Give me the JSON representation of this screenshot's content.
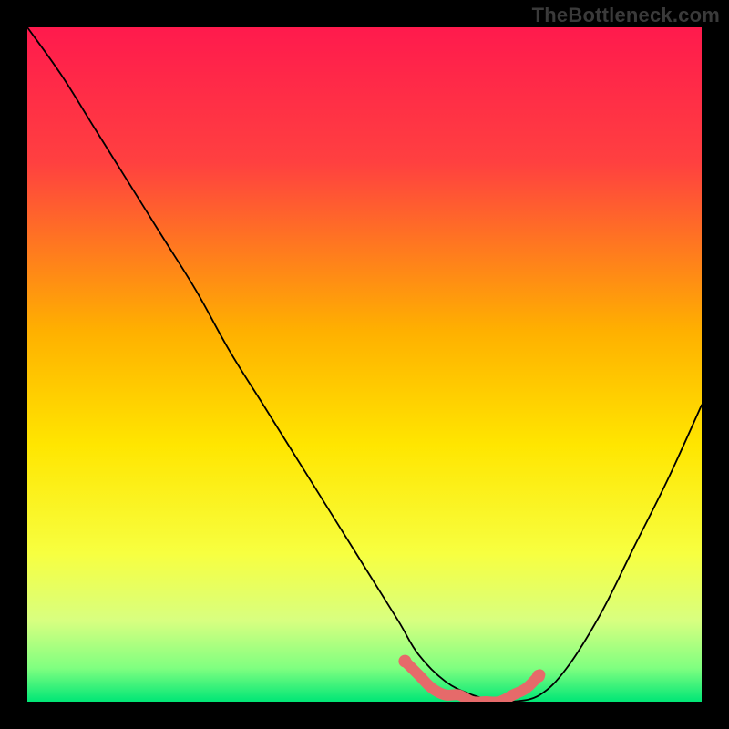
{
  "watermark": "TheBottleneck.com",
  "chart_data": {
    "type": "line",
    "title": "",
    "xlabel": "",
    "ylabel": "",
    "xlim": [
      0,
      100
    ],
    "ylim": [
      0,
      100
    ],
    "gradient_stops": [
      {
        "offset": 0.0,
        "color": "#ff1a4d"
      },
      {
        "offset": 0.2,
        "color": "#ff4040"
      },
      {
        "offset": 0.45,
        "color": "#ffb000"
      },
      {
        "offset": 0.62,
        "color": "#ffe600"
      },
      {
        "offset": 0.78,
        "color": "#f7ff40"
      },
      {
        "offset": 0.88,
        "color": "#d8ff80"
      },
      {
        "offset": 0.95,
        "color": "#80ff80"
      },
      {
        "offset": 1.0,
        "color": "#00e676"
      }
    ],
    "series": [
      {
        "name": "bottleneck-curve",
        "color": "#000000",
        "width": 1.8,
        "x": [
          0,
          5,
          10,
          15,
          20,
          25,
          30,
          35,
          40,
          45,
          50,
          55,
          58,
          62,
          66,
          70,
          72,
          76,
          80,
          85,
          90,
          95,
          100
        ],
        "y": [
          100,
          93,
          85,
          77,
          69,
          61,
          52,
          44,
          36,
          28,
          20,
          12,
          7,
          3,
          1,
          0,
          0,
          1,
          5,
          13,
          23,
          33,
          44
        ]
      },
      {
        "name": "optimal-band",
        "color": "#e66a6a",
        "width": 12,
        "x": [
          56,
          58,
          60,
          62,
          64,
          66,
          68,
          70,
          72,
          74,
          76
        ],
        "y": [
          6,
          4,
          2,
          1,
          1,
          0,
          0,
          0,
          1,
          2,
          4
        ]
      }
    ],
    "dots": [
      {
        "x": 56.0,
        "y": 6.0,
        "r": 7,
        "color": "#e66a6a"
      },
      {
        "x": 75.8,
        "y": 3.8,
        "r": 7,
        "color": "#e66a6a"
      }
    ]
  }
}
